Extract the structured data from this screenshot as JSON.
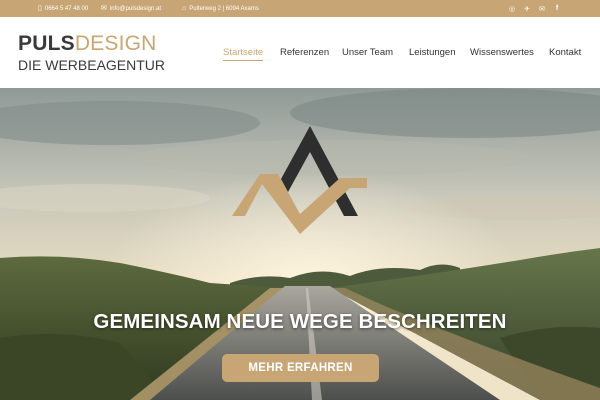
{
  "topbar": {
    "phone": "0664 5 47 48 00",
    "email": "info@pulsdesign.at",
    "address": "Pulterweg 2 | 6094 Axams",
    "social": [
      {
        "icon": "instagram-icon",
        "glyph": "◎"
      },
      {
        "icon": "paper-plane-icon",
        "glyph": "✈"
      },
      {
        "icon": "mail-icon",
        "glyph": "✉"
      },
      {
        "icon": "facebook-icon",
        "glyph": "f"
      }
    ]
  },
  "logo": {
    "puls": "PULS",
    "design": "DESIGN",
    "tagline": "DIE WERBEAGENTUR"
  },
  "nav": {
    "items": [
      {
        "label": "Startseite",
        "active": true
      },
      {
        "label": "Referenzen",
        "active": false
      },
      {
        "label": "Unser Team",
        "active": false
      },
      {
        "label": "Leistungen",
        "active": false
      },
      {
        "label": "Wissenswertes",
        "active": false
      },
      {
        "label": "Kontakt",
        "active": false
      }
    ]
  },
  "hero": {
    "headline": "GEMEINSAM NEUE WEGE BESCHREITEN",
    "cta_label": "MEHR ERFAHREN"
  },
  "colors": {
    "accent": "#c8a574",
    "text": "#333333",
    "mark_dark": "#2e2e2e"
  }
}
